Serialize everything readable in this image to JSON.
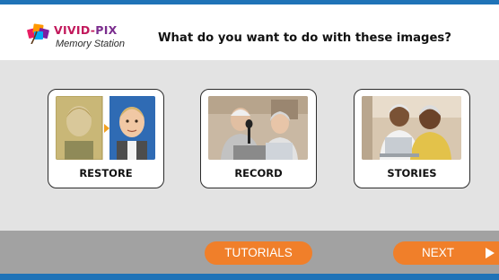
{
  "app": {
    "logo_brand_part1": "VIVID-",
    "logo_brand_part2": "PIX",
    "logo_subtitle": "Memory Station",
    "logo_icon": "photo-stack-icon"
  },
  "header": {
    "title": "What do you want to do with these images?"
  },
  "options": [
    {
      "label": "RESTORE",
      "image": "restore-before-after-photo"
    },
    {
      "label": "RECORD",
      "image": "record-seniors-podcast-photo"
    },
    {
      "label": "STORIES",
      "image": "stories-seniors-laptop-photo"
    }
  ],
  "footer": {
    "tutorials_label": "TUTORIALS",
    "next_label": "NEXT",
    "next_icon": "play-arrow-icon"
  },
  "colors": {
    "accent_blue": "#1f73b7",
    "button_orange": "#f07f2a",
    "main_bg": "#e3e3e3",
    "footer_bg": "#a2a2a2",
    "brand_magenta": "#c2185b",
    "close_red": "#e53935"
  }
}
